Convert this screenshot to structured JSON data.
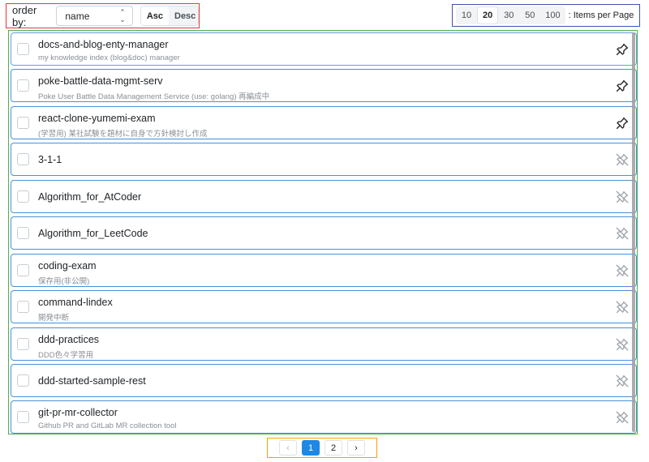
{
  "toolbar": {
    "order_by_label": "order by:",
    "order_by_value": "name",
    "sort_asc_label": "Asc",
    "sort_desc_label": "Desc",
    "sort_active": "Asc",
    "items_per_page_options": [
      "10",
      "20",
      "30",
      "50",
      "100"
    ],
    "items_per_page_selected": "20",
    "items_per_page_label": ": Items per Page"
  },
  "repos": [
    {
      "name": "docs-and-blog-enty-manager",
      "description": "my knowledge index (blog&doc) manager",
      "pinned": true
    },
    {
      "name": "poke-battle-data-mgmt-serv",
      "description": "Poke User Battle Data Management Service (use: golang) 再編成中",
      "pinned": true
    },
    {
      "name": "react-clone-yumemi-exam",
      "description": "(学習用) 某社試験を題材に自身で方針検討し作成",
      "pinned": true
    },
    {
      "name": "3-1-1",
      "description": "",
      "pinned": false
    },
    {
      "name": "Algorithm_for_AtCoder",
      "description": "",
      "pinned": false
    },
    {
      "name": "Algorithm_for_LeetCode",
      "description": "",
      "pinned": false
    },
    {
      "name": "coding-exam",
      "description": "保存用(非公開)",
      "pinned": false
    },
    {
      "name": "command-lindex",
      "description": "開発中断",
      "pinned": false
    },
    {
      "name": "ddd-practices",
      "description": "DDD色々学習用",
      "pinned": false
    },
    {
      "name": "ddd-started-sample-rest",
      "description": "",
      "pinned": false
    },
    {
      "name": "git-pr-mr-collector",
      "description": "Github PR and GitLab MR collection tool",
      "pinned": false
    }
  ],
  "pagination": {
    "prev_label": "‹",
    "pages": [
      "1",
      "2"
    ],
    "current": "1",
    "next_label": "›"
  },
  "icons": {
    "pinned": "pin-icon",
    "unpinned": "pin-off-icon",
    "select_caret": "chevron-updown-icon"
  },
  "colors": {
    "accent": "#1e88e5",
    "item_border": "#4a90d9",
    "pin_active": "#212529",
    "pin_inactive": "#a0a6ad"
  }
}
